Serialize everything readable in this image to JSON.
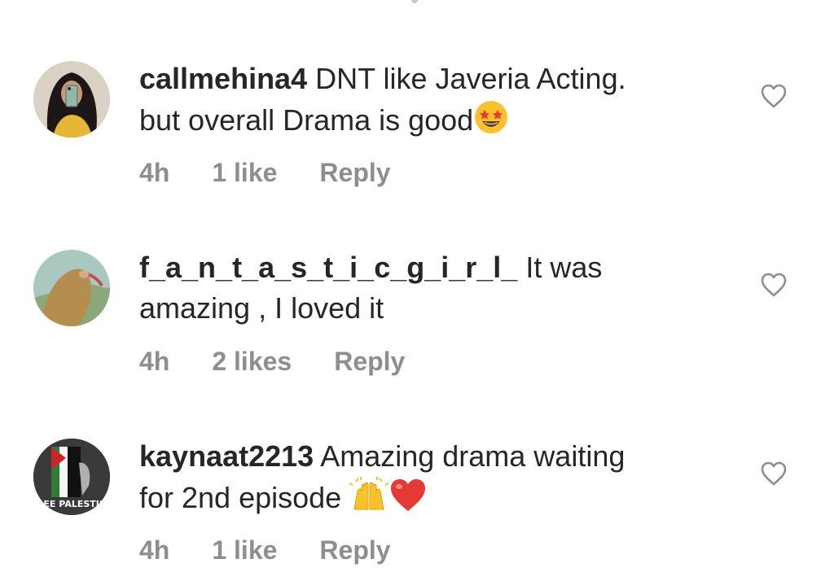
{
  "comments": [
    {
      "username": "callmehina4",
      "text_line1": " DNT like Javeria Acting.",
      "text_line2": "but overall Drama is good",
      "emoji": "star-struck",
      "time": "4h",
      "likes": "1 like",
      "reply": "Reply"
    },
    {
      "username": "f_a_n_t_a_s_t_i_c_g_i_r_l_",
      "text_line1": " It was",
      "text_line2": "amazing , I loved it",
      "time": "4h",
      "likes": "2 likes",
      "reply": "Reply"
    },
    {
      "username": "kaynaat2213",
      "text_line1": " Amazing drama waiting",
      "text_line2": "for 2nd episode ",
      "emoji": "raising-hands-red-heart",
      "avatar_text": "FREE PALESTINE",
      "time": "4h",
      "likes": "1 like",
      "reply": "Reply"
    }
  ]
}
